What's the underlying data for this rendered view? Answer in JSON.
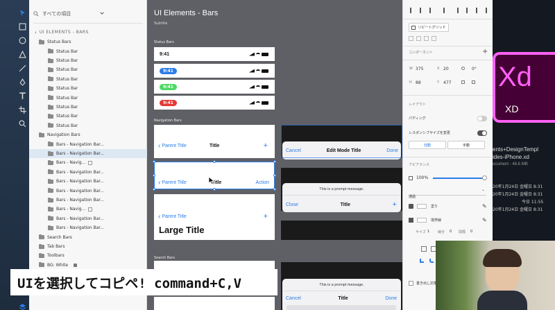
{
  "layers": {
    "search_label": "すべての項目",
    "artboard_name": "UI ELEMENTS - BARS",
    "items": [
      {
        "label": "Status Bars",
        "level": 0,
        "selected": false
      },
      {
        "label": "Status Bar",
        "level": 1
      },
      {
        "label": "Status Bar",
        "level": 1
      },
      {
        "label": "Status Bar",
        "level": 1
      },
      {
        "label": "Status Bar",
        "level": 1
      },
      {
        "label": "Status Bar",
        "level": 1
      },
      {
        "label": "Status Bar",
        "level": 1
      },
      {
        "label": "Status Bar",
        "level": 1
      },
      {
        "label": "Status Bar",
        "level": 1
      },
      {
        "label": "Status Bar",
        "level": 1
      },
      {
        "label": "Navigation Bars",
        "level": 0
      },
      {
        "label": "Bars - Navigation Bar...",
        "level": 1
      },
      {
        "label": "Bars - Navigation Bar...",
        "level": 1,
        "selected": true
      },
      {
        "label": "Bars - Navig...",
        "level": 1,
        "link": true
      },
      {
        "label": "Bars - Navigation Bar...",
        "level": 1
      },
      {
        "label": "Bars - Navigation Bar...",
        "level": 1
      },
      {
        "label": "Bars - Navigation Bar...",
        "level": 1
      },
      {
        "label": "Bars - Navigation Bar...",
        "level": 1
      },
      {
        "label": "Bars - Navig...",
        "level": 1,
        "link": true
      },
      {
        "label": "Bars - Navigation Bar...",
        "level": 1
      },
      {
        "label": "Bars - Navigation Bar...",
        "level": 1
      },
      {
        "label": "Search Bars",
        "level": 0
      },
      {
        "label": "Tab Bars",
        "level": 0
      },
      {
        "label": "Toolbars",
        "level": 0
      },
      {
        "label": "BG: White",
        "level": 0,
        "lock": true
      }
    ]
  },
  "canvas": {
    "title": "UI Elements - Bars",
    "subtitle": "Subtitle",
    "status_label": "Status Bars",
    "nav_label": "Navigation Bars",
    "search_label": "Search Bars",
    "status_bars": [
      {
        "time": "9:41",
        "pill": null
      },
      {
        "time": "9:41",
        "pill": "#2b7ce9"
      },
      {
        "time": "9:41",
        "pill": "#4cd964"
      },
      {
        "time": "9:41",
        "pill": "#e53935"
      }
    ],
    "nav1": {
      "back": "Parent Title",
      "title": "Title",
      "action": "+"
    },
    "nav2": {
      "back": "Parent Title",
      "title": "Title",
      "action": "Action"
    },
    "nav3": {
      "back": "Parent Title",
      "action": "+",
      "large": "Large Title"
    },
    "sheet1": {
      "left": "Cancel",
      "title": "Edit Mode Title",
      "right": "Done"
    },
    "sheet2": {
      "prompt": "This is a prompt message.",
      "left": "Close",
      "title": "Title",
      "right": "+"
    },
    "sheet3": {
      "prompt": "This is a prompt message.",
      "left": "Cancel",
      "title": "Title",
      "right": "Done"
    }
  },
  "props": {
    "repeat_grid": "リピートグリッド",
    "component": "コンポーネント",
    "w_label": "W",
    "w": "375",
    "x_label": "X",
    "x": "20",
    "rot": "0°",
    "h_label": "H",
    "h": "88",
    "y_label": "Y",
    "y": "477",
    "layout": "レイアウト",
    "padding": "パディング",
    "responsive": "レスポンシブサイズを変更",
    "auto": "自動",
    "manual": "手動",
    "appearance": "アピアランス",
    "opacity": "100%",
    "blend": "通過",
    "fill": "塗り",
    "border": "境界線",
    "size_lbl": "サイズ",
    "size": "1",
    "gap_lbl": "線分",
    "gap": "0",
    "gap2_lbl": "間隔",
    "gap2": "0",
    "export": "書き出し対象"
  },
  "bg": {
    "logo_main": "Xd",
    "logo_sub": "XD",
    "file_line1": "ents+DesignTempl",
    "file_line2": "ides-iPhone.xd",
    "file_line3": "ocument - 48.6 MB",
    "date1": "20年1月24日 金曜日 8:31",
    "date2": "20年1月24日 金曜日 8:31",
    "date3": "今日 11:55",
    "date4": "20年1月24日 金曜日 8:31"
  },
  "caption": "UIを選択してコピペ! command+C,V"
}
